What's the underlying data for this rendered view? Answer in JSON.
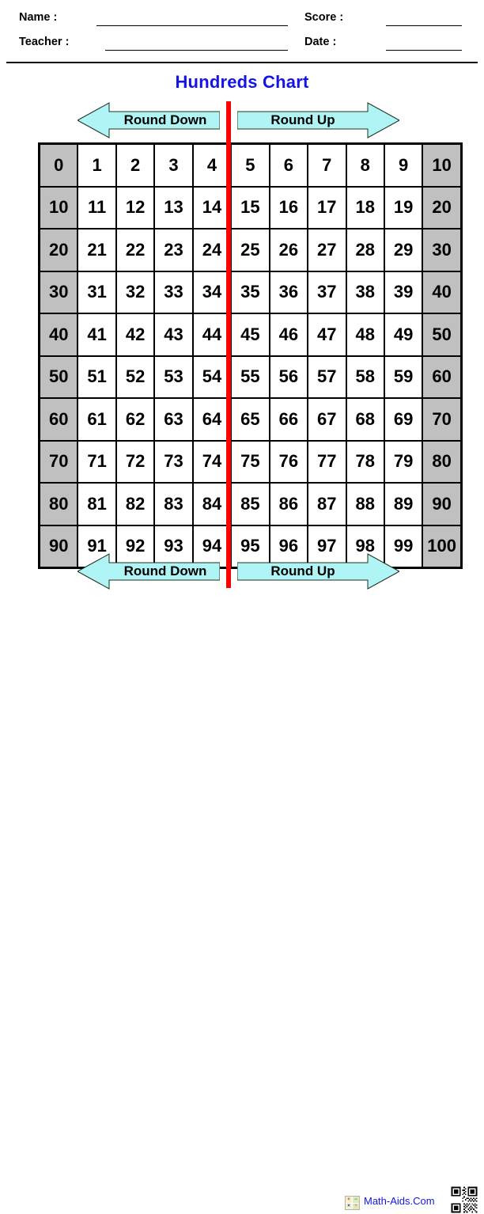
{
  "header": {
    "name_label": "Name :",
    "teacher_label": "Teacher :",
    "score_label": "Score :",
    "date_label": "Date :",
    "name_value": "",
    "teacher_value": "",
    "score_value": "",
    "date_value": ""
  },
  "title": "Hundreds Chart",
  "banners": {
    "top": {
      "left_label": "Round Down",
      "right_label": "Round Up"
    },
    "bottom": {
      "left_label": "Round Down",
      "right_label": "Round Up"
    }
  },
  "colors": {
    "title_blue": "#1414e6",
    "divider_red": "#fe0000",
    "arrow_fill": "#b0f5f5",
    "shaded_cell": "#c0c0c0",
    "cell_border": "#000000",
    "link_blue": "#1414e6"
  },
  "chart_data": {
    "type": "table",
    "title": "Hundreds Chart",
    "columns": 11,
    "rows_count": 10,
    "shaded_columns": [
      0,
      10
    ],
    "divider_after_column": 4,
    "rows": [
      [
        "0",
        "1",
        "2",
        "3",
        "4",
        "5",
        "6",
        "7",
        "8",
        "9",
        "10"
      ],
      [
        "10",
        "11",
        "12",
        "13",
        "14",
        "15",
        "16",
        "17",
        "18",
        "19",
        "20"
      ],
      [
        "20",
        "21",
        "22",
        "23",
        "24",
        "25",
        "26",
        "27",
        "28",
        "29",
        "30"
      ],
      [
        "30",
        "31",
        "32",
        "33",
        "34",
        "35",
        "36",
        "37",
        "38",
        "39",
        "40"
      ],
      [
        "40",
        "41",
        "42",
        "43",
        "44",
        "45",
        "46",
        "47",
        "48",
        "49",
        "50"
      ],
      [
        "50",
        "51",
        "52",
        "53",
        "54",
        "55",
        "56",
        "57",
        "58",
        "59",
        "60"
      ],
      [
        "60",
        "61",
        "62",
        "63",
        "64",
        "65",
        "66",
        "67",
        "68",
        "69",
        "70"
      ],
      [
        "70",
        "71",
        "72",
        "73",
        "74",
        "75",
        "76",
        "77",
        "78",
        "79",
        "80"
      ],
      [
        "80",
        "81",
        "82",
        "83",
        "84",
        "85",
        "86",
        "87",
        "88",
        "89",
        "90"
      ],
      [
        "90",
        "91",
        "92",
        "93",
        "94",
        "95",
        "96",
        "97",
        "98",
        "99",
        "100"
      ]
    ]
  },
  "footer": {
    "site_name": "Math-Aids.Com",
    "logo_symbols": [
      "+",
      "−",
      "×",
      "÷"
    ]
  }
}
